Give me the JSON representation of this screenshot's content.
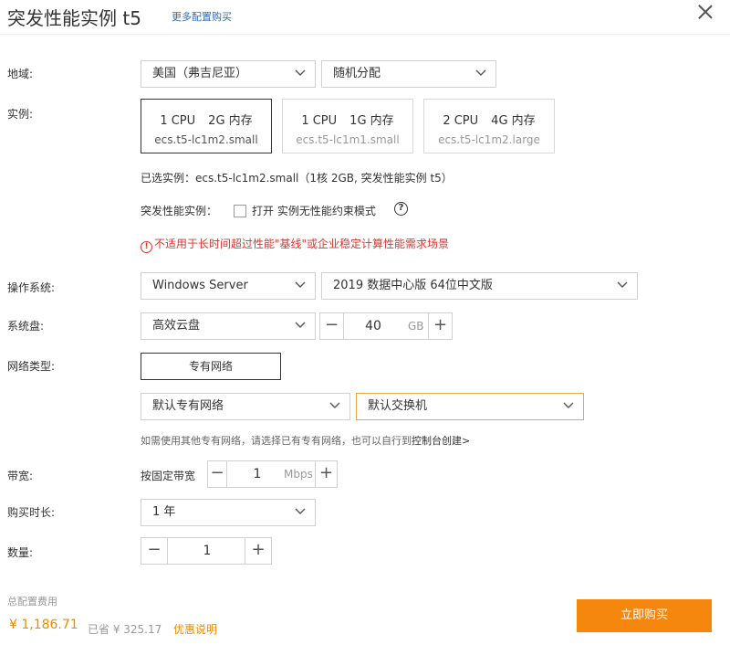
{
  "header": {
    "title": "突发性能实例 t5",
    "more_link": "更多配置购买"
  },
  "region": {
    "label": "地域:",
    "region_value": "美国（弗吉尼亚）",
    "zone_value": "随机分配"
  },
  "instance": {
    "label": "实例:",
    "cards": [
      {
        "cpu": "1 CPU",
        "mem": "2G 内存",
        "code": "ecs.t5-lc1m2.small",
        "selected": true
      },
      {
        "cpu": "1 CPU",
        "mem": "1G 内存",
        "code": "ecs.t5-lc1m1.small",
        "selected": false
      },
      {
        "cpu": "2 CPU",
        "mem": "4G 内存",
        "code": "ecs.t5-lc1m2.large",
        "selected": false
      }
    ],
    "selected_info": "已选实例：ecs.t5-lc1m2.small（1核 2GB, 突发性能实例 t5）",
    "burst_label": "突发性能实例：",
    "burst_option": "打开 实例无性能约束模式",
    "help_glyph": "?",
    "warning_glyph": "!",
    "warning": "不适用于长时间超过性能\"基线\"或企业稳定计算性能需求场景"
  },
  "os": {
    "label": "操作系统:",
    "type_value": "Windows Server",
    "version_value": "2019 数据中心版 64位中文版"
  },
  "disk": {
    "label": "系统盘:",
    "type_value": "高效云盘",
    "size": "40",
    "unit": "GB"
  },
  "network": {
    "label": "网络类型:",
    "type_button": "专有网络",
    "vpc_value": "默认专有网络",
    "vswitch_value": "默认交换机",
    "hint": "如需使用其他专有网络，请选择已有专有网络，也可以自行到",
    "hint_link": "控制台创建>"
  },
  "bandwidth": {
    "label": "带宽:",
    "mode": "按固定带宽",
    "value": "1",
    "unit": "Mbps"
  },
  "duration": {
    "label": "购买时长:",
    "value": "1 年"
  },
  "quantity": {
    "label": "数量:",
    "value": "1"
  },
  "footer": {
    "total_label": "总配置费用",
    "price": "¥ 1,186.71",
    "saved": "已省 ¥ 325.17",
    "promo": "优惠说明",
    "buy_button": "立即购买"
  },
  "icons": {
    "minus": "−",
    "plus": "+"
  },
  "colors": {
    "accent": "#f5870f",
    "price": "#f08a00",
    "link": "#2f6db5",
    "warning": "#d9362b"
  }
}
